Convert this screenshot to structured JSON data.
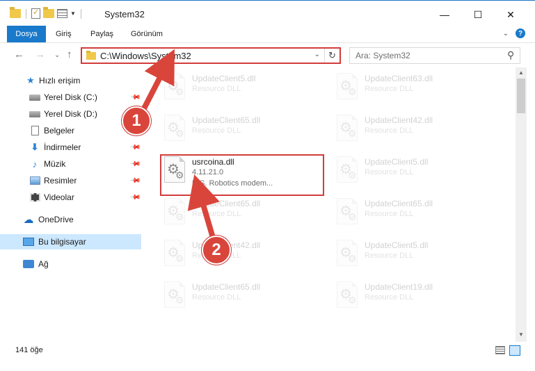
{
  "window": {
    "title": "System32",
    "minimize_glyph": "—",
    "maximize_glyph": "☐",
    "close_glyph": "✕"
  },
  "ribbon": {
    "file_tab": "Dosya",
    "tabs": [
      "Giriş",
      "Paylaş",
      "Görünüm"
    ],
    "help_glyph": "?",
    "expand_glyph": "⌄"
  },
  "nav": {
    "back_glyph": "←",
    "forward_glyph": "→",
    "recent_glyph": "⌄",
    "up_glyph": "↑",
    "address": "C:\\Windows\\System32",
    "address_dropdown_glyph": "⌄",
    "refresh_glyph": "↻",
    "search_placeholder": "Ara: System32",
    "search_glyph": "⚲"
  },
  "sidebar": {
    "items": [
      {
        "label": "Hızlı erişim",
        "icon": "star-icon"
      },
      {
        "label": "Yerel Disk (C:)",
        "icon": "drive-icon",
        "pinned": true
      },
      {
        "label": "Yerel Disk (D:)",
        "icon": "drive-icon"
      },
      {
        "label": "Belgeler",
        "icon": "document-icon",
        "pinned": true
      },
      {
        "label": "İndirmeler",
        "icon": "download-icon",
        "pinned": true
      },
      {
        "label": "Müzik",
        "icon": "music-icon",
        "pinned": true
      },
      {
        "label": "Resimler",
        "icon": "pictures-icon",
        "pinned": true
      },
      {
        "label": "Videolar",
        "icon": "videos-icon",
        "pinned": true
      },
      {
        "label": "OneDrive",
        "icon": "cloud-icon"
      },
      {
        "label": "Bu bilgisayar",
        "icon": "computer-icon",
        "selected": true
      },
      {
        "label": "Ağ",
        "icon": "network-icon"
      }
    ]
  },
  "files": {
    "left": [
      {
        "name": "UpdateClient5.dll",
        "desc": "Resource DLL",
        "faded": true
      },
      {
        "name": "UpdateClient65.dll",
        "desc": "Resource DLL",
        "faded": true
      },
      {
        "name": "usrcoina.dll",
        "desc": "4.11.21.0",
        "desc2": "U.S. Robotics modem...",
        "faded": false
      },
      {
        "name": "UpdateClient65.dll",
        "desc": "Resource DLL",
        "faded": true
      },
      {
        "name": "UpdateClient42.dll",
        "desc": "Resource DLL",
        "faded": true
      },
      {
        "name": "UpdateClient65.dll",
        "desc": "Resource DLL",
        "faded": true
      }
    ],
    "right": [
      {
        "name": "UpdateClient63.dll",
        "desc": "Resource DLL",
        "faded": true
      },
      {
        "name": "UpdateClient42.dll",
        "desc": "Resource DLL",
        "faded": true
      },
      {
        "name": "UpdateClient5.dll",
        "desc": "Resource DLL",
        "faded": true
      },
      {
        "name": "UpdateClient65.dll",
        "desc": "Resource DLL",
        "faded": true
      },
      {
        "name": "UpdateClient5.dll",
        "desc": "Resource DLL",
        "faded": true
      },
      {
        "name": "UpdateClient19.dll",
        "desc": "Resource DLL",
        "faded": true
      }
    ]
  },
  "status": {
    "item_count": "141 öğe"
  },
  "annotations": {
    "step1": "1",
    "step2": "2",
    "accent_color": "#d9453b"
  }
}
